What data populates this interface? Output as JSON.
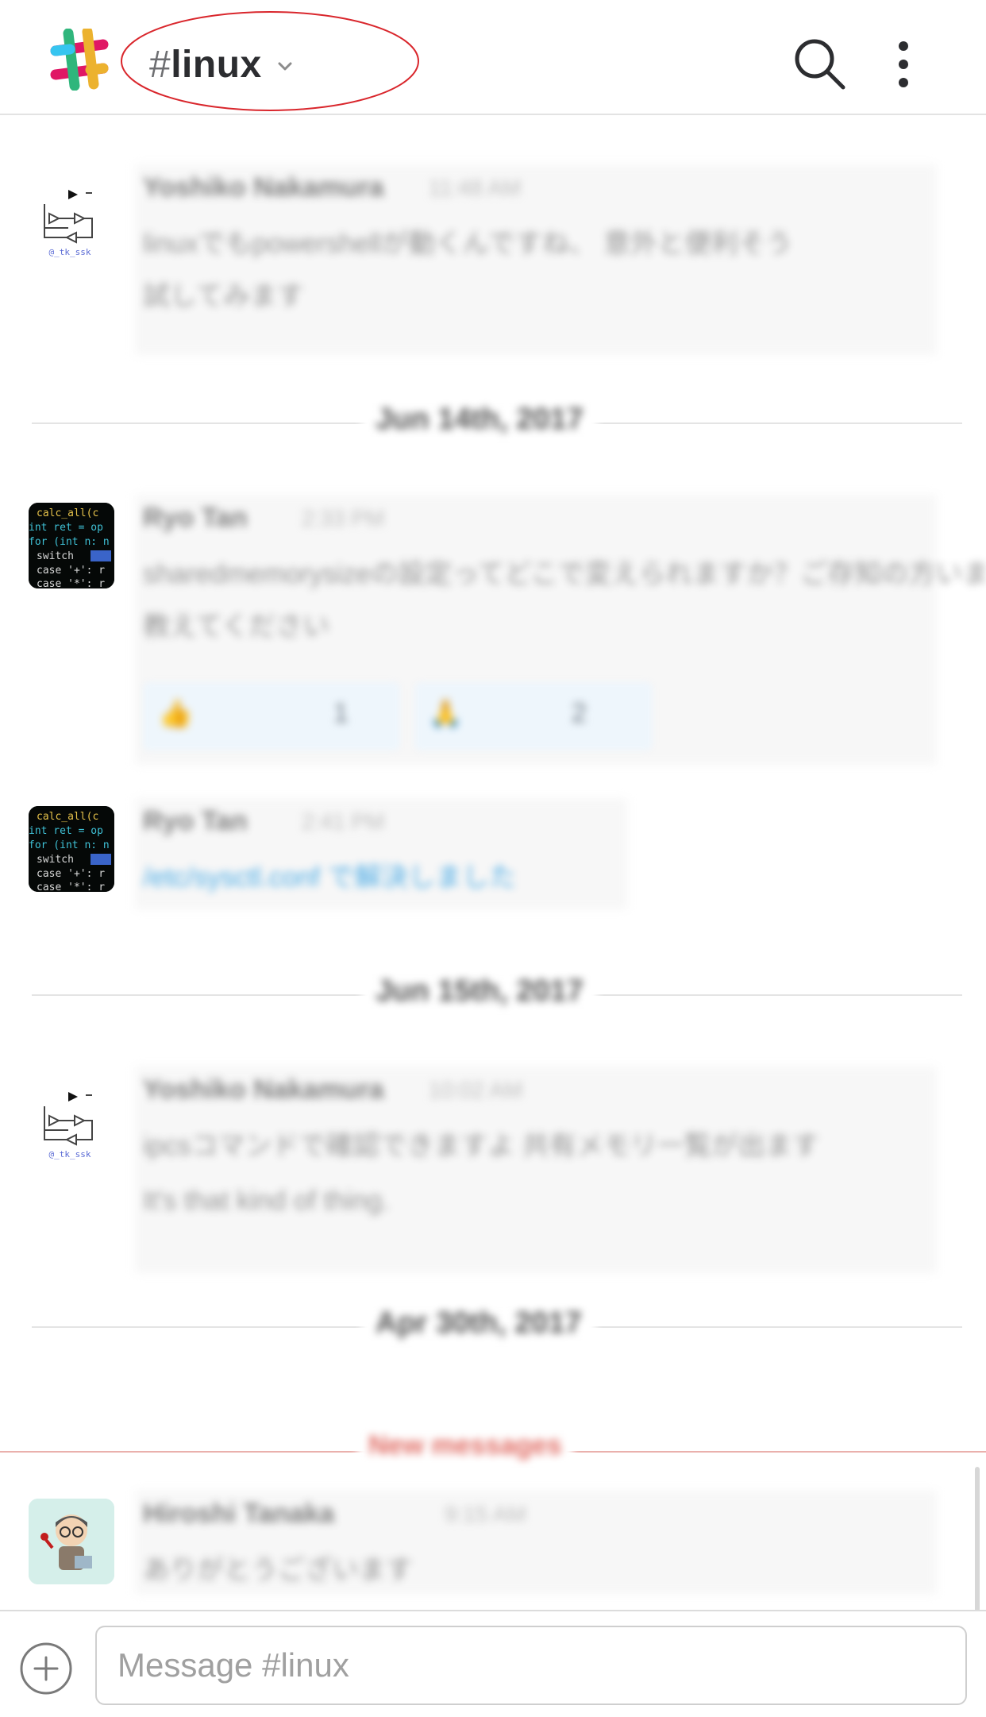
{
  "header": {
    "channel_hash": "#",
    "channel_name": "linux",
    "annotation_color": "#d9262c",
    "icons": [
      "slack-logo-icon",
      "chevron-down-icon",
      "search-icon",
      "more-vertical-icon"
    ]
  },
  "messages": {
    "items": [
      {
        "avatar": "circuit-diagram",
        "avatar_caption": "@_tk_ssk",
        "author": "Yoshiko Nakamura",
        "time": "11:48 AM",
        "lines": [
          "linuxでもpowershellが動くんですね、 意外と便利そう",
          "試してみます"
        ]
      },
      {
        "avatar": "code-editor",
        "author": "Ryo Tan",
        "time": "2:33 PM",
        "lines": [
          "sharedmemorysizeの設定ってどこで変えられますか？ご存知の方いますか",
          "教えてください"
        ],
        "reactions": [
          {
            "emoji": "👍",
            "count": "1"
          },
          {
            "emoji": "🙏",
            "count": "2"
          }
        ]
      },
      {
        "avatar": "code-editor",
        "author": "Ryo Tan",
        "time": "2:41 PM",
        "lines": [
          "/etc/sysctl.conf で解決しました"
        ]
      },
      {
        "avatar": "circuit-diagram",
        "avatar_caption": "@_tk_ssk",
        "author": "Yoshiko Nakamura",
        "time": "10:02 AM",
        "lines": [
          "ipcsコマンドで確認できますよ 共有メモリ一覧が出ます",
          "It's that kind of thing."
        ]
      },
      {
        "avatar": "cartoon-person",
        "author": "Hiroshi Tanaka",
        "time": "9:15 AM",
        "lines": [
          "ありがとうございます"
        ]
      }
    ],
    "date_dividers": [
      "Jun 14th, 2017",
      "Jun 15th, 2017",
      "Apr 30th, 2017"
    ],
    "new_divider": "New messages"
  },
  "composer": {
    "placeholder": "Message #linux",
    "value": ""
  }
}
